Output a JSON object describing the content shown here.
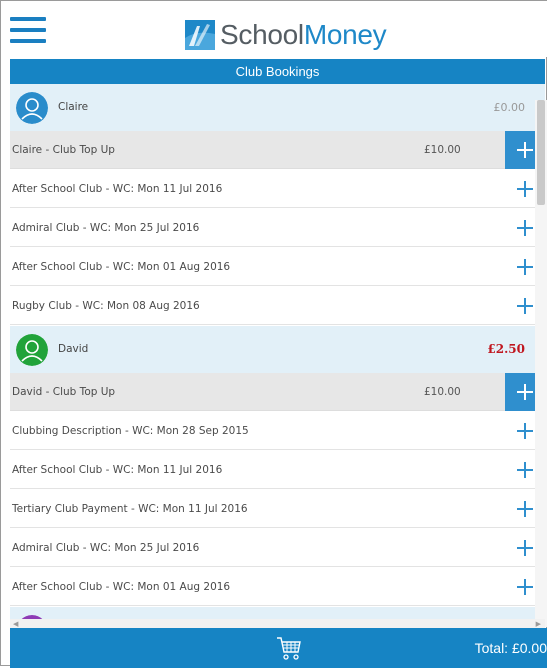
{
  "app": {
    "brand_part1": "School",
    "brand_part2": "Money"
  },
  "titlebar": {
    "title": "Club Bookings"
  },
  "children": [
    {
      "name": "Claire",
      "balance": "£0.00",
      "avatar_color": "#2a8ccb",
      "topup": {
        "label": "Claire - Club Top Up",
        "price": "£10.00"
      },
      "clubs": [
        "After School Club - WC: Mon 11 Jul 2016",
        "Admiral Club - WC: Mon 25 Jul 2016",
        "After School Club - WC: Mon 01 Aug 2016",
        "Rugby Club - WC: Mon 08 Aug 2016"
      ]
    },
    {
      "name": "David",
      "balance": "£2.50",
      "avatar_color": "#21a33a",
      "topup": {
        "label": "David - Club Top Up",
        "price": "£10.00"
      },
      "clubs": [
        "Clubbing Description - WC: Mon 28 Sep 2015",
        "After School Club - WC: Mon 11 Jul 2016",
        "Tertiary Club Payment - WC: Mon 11 Jul 2016",
        "Admiral Club - WC: Mon 25 Jul 2016",
        "After School Club - WC: Mon 01 Aug 2016"
      ]
    },
    {
      "name": "",
      "balance": "",
      "avatar_color": "#8e3bb5"
    }
  ],
  "footer": {
    "total": "Total: £0.00"
  },
  "colors": {
    "accent": "#1684c4",
    "plus_blue": "#2f8fce",
    "negative": "#c0161f"
  },
  "icons": {
    "menu": "hamburger-icon",
    "cart": "shopping-cart-icon",
    "add": "plus-icon",
    "person": "user-icon"
  }
}
